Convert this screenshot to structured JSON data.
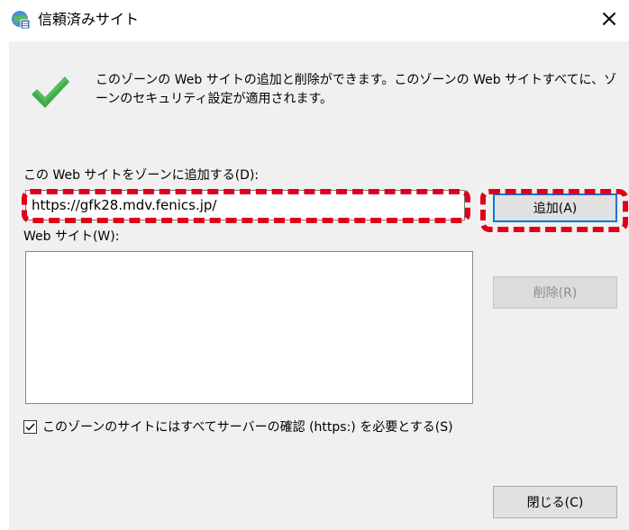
{
  "window": {
    "title": "信頼済みサイト",
    "close_glyph": "×"
  },
  "description": "このゾーンの Web サイトの追加と削除ができます。このゾーンの Web サイトすべてに、ゾーンのセキュリティ設定が適用されます。",
  "add_section": {
    "label": "この Web サイトをゾーンに追加する(D):",
    "url_value": "https://gfk28.mdv.fenics.jp/",
    "add_button": "追加(A)"
  },
  "sites_section": {
    "label": "Web サイト(W):",
    "items": [],
    "remove_button": "削除(R)"
  },
  "https_requirement": {
    "label": "このゾーンのサイトにはすべてサーバーの確認 (https:) を必要とする(S)",
    "checked": true
  },
  "close_button": "閉じる(C)",
  "icons": {
    "title": "globe-shield-icon",
    "check": "green-check-icon",
    "close": "close-icon"
  },
  "colors": {
    "dialog_bg": "#f0f0f0",
    "highlight": "#e0001b",
    "focus_border": "#0078d7",
    "check_green": "#3fae4a"
  }
}
